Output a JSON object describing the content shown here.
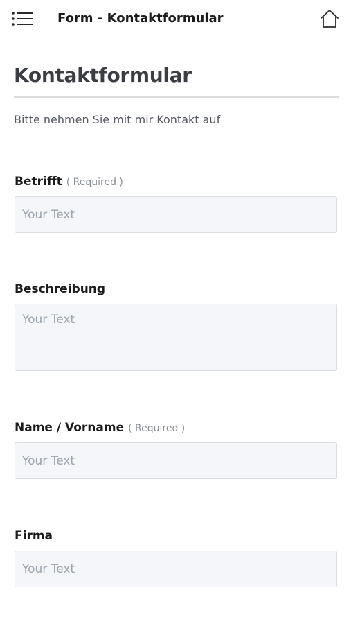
{
  "header": {
    "title": "Form  -  Kontaktformular",
    "menu_icon": "list-icon",
    "home_icon": "home-icon"
  },
  "page": {
    "title": "Kontaktformular",
    "intro": "Bitte nehmen Sie mit mir Kontakt auf"
  },
  "form": {
    "required_label": "( Required )",
    "fields": [
      {
        "label": "Betrifft",
        "required": true,
        "placeholder": "Your Text",
        "value": ""
      },
      {
        "label": "Beschreibung",
        "required": false,
        "placeholder": "Your Text",
        "value": ""
      },
      {
        "label": "Name / Vorname",
        "required": true,
        "placeholder": "Your Text",
        "value": ""
      },
      {
        "label": "Firma",
        "required": false,
        "placeholder": "Your Text",
        "value": ""
      }
    ]
  },
  "colors": {
    "input_background": "#f4f6fa",
    "input_border": "#d9dce1",
    "title_color": "#3a3d42"
  }
}
